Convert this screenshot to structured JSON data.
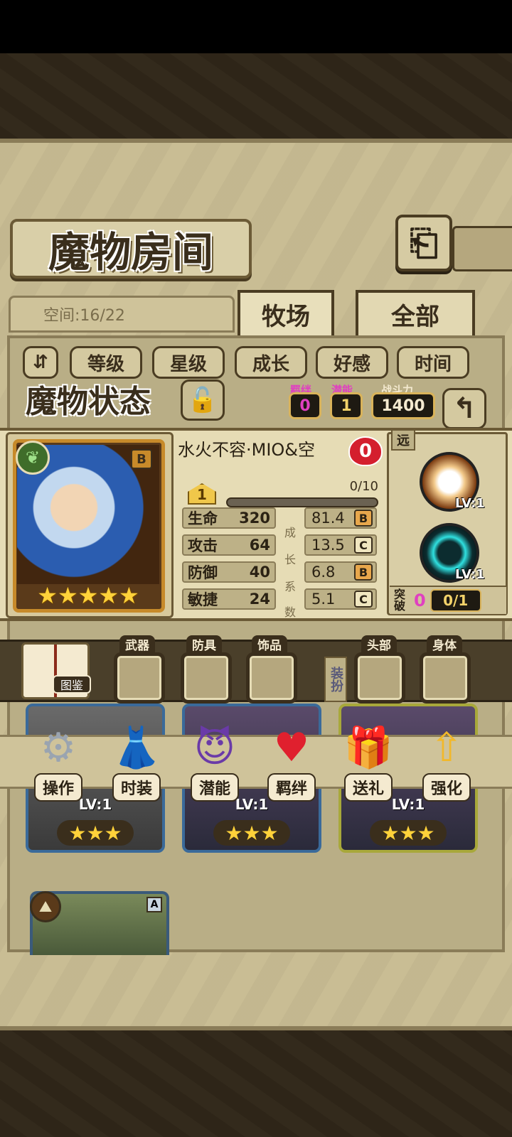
{
  "title": "魔物房间",
  "back_icon": "return-arrow-icon",
  "space": "空间:16/22",
  "tabs": [
    {
      "label": "牧场"
    },
    {
      "label": "全部"
    }
  ],
  "sort_buttons": [
    "等级",
    "星级",
    "成长",
    "好感",
    "时间"
  ],
  "status": {
    "title": "魔物状态",
    "bond_label": "羁绊",
    "bond_value": "0",
    "potential_label": "潜能",
    "potential_value": "1",
    "power_label": "战斗力",
    "power_value": "1400"
  },
  "monster": {
    "name": "水火不容·MIO&空",
    "affection": "0",
    "grade": "B",
    "stars": 5,
    "level": "1",
    "exp": "0/10",
    "exp_fraction": 0,
    "stats": [
      {
        "label": "生命",
        "value": "320",
        "growth": "81.4",
        "grade": "B"
      },
      {
        "label": "攻击",
        "value": "64",
        "growth": "13.5",
        "grade": "C"
      },
      {
        "label": "防御",
        "value": "40",
        "growth": "6.8",
        "grade": "B"
      },
      {
        "label": "敏捷",
        "value": "24",
        "growth": "5.1",
        "grade": "C"
      }
    ],
    "growth_label": [
      "成",
      "长",
      "系",
      "数"
    ]
  },
  "skills": {
    "range": "远",
    "items": [
      {
        "level": "LV:1",
        "icon": "explosion-skill-icon"
      },
      {
        "level": "LV:1",
        "icon": "vortex-skill-icon"
      }
    ],
    "break_label": "突破",
    "break_count": "0",
    "break_value": "0/1"
  },
  "equipment": {
    "book_label": "图鉴",
    "slots": [
      "武器",
      "防具",
      "饰品",
      "头部",
      "身体"
    ],
    "outfit_tag": "装扮"
  },
  "actions": [
    {
      "label": "操作",
      "icon": "gear-icon"
    },
    {
      "label": "时装",
      "icon": "clothes-icon"
    },
    {
      "label": "潜能",
      "icon": "demon-icon"
    },
    {
      "label": "羁绊",
      "icon": "hearts-icon"
    },
    {
      "label": "送礼",
      "icon": "gift-icon"
    },
    {
      "label": "强化",
      "icon": "upgrade-arrows-icon"
    }
  ],
  "list_cards": [
    {
      "level": "LV:1",
      "stars": 3
    },
    {
      "level": "LV:1",
      "stars": 3
    },
    {
      "level": "LV:1",
      "stars": 3
    }
  ],
  "extra_card_grade": "A"
}
